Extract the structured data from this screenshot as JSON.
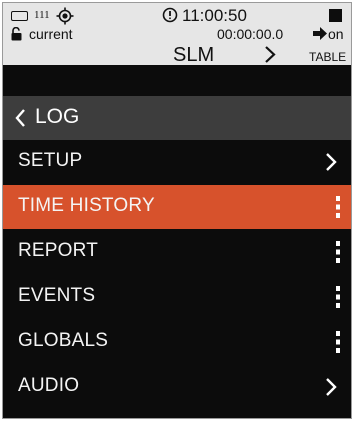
{
  "status_bar": {
    "count": "111",
    "time": "11:00:50",
    "mode": "current",
    "elapsed": "00:00:00.0",
    "run_state": "on",
    "title": "SLM",
    "table_label": "TABLE"
  },
  "header": {
    "label": "LOG",
    "back_icon": "chevron-left-icon"
  },
  "menu": {
    "items": [
      {
        "label": "SETUP",
        "icon": "chevron-right-icon"
      },
      {
        "label": "TIME HISTORY",
        "icon": "kebab-icon",
        "selected": true
      },
      {
        "label": "REPORT",
        "icon": "kebab-icon"
      },
      {
        "label": "EVENTS",
        "icon": "kebab-icon"
      },
      {
        "label": "GLOBALS",
        "icon": "kebab-icon"
      },
      {
        "label": "AUDIO",
        "icon": "chevron-right-icon"
      }
    ]
  },
  "colors": {
    "accent": "#d7522c",
    "header_bg": "#3d3d3d",
    "screen_bg": "#0c0c0c",
    "status_bg": "#e6e6e6"
  }
}
